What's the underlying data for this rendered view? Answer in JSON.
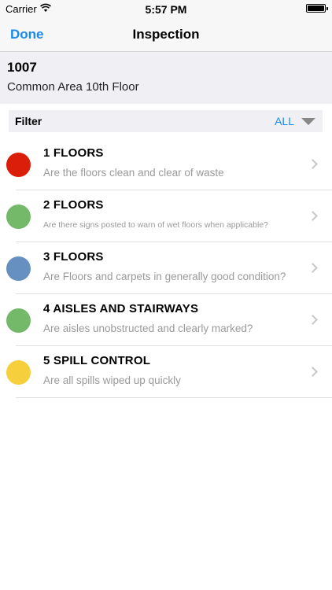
{
  "status_bar": {
    "carrier": "Carrier",
    "time": "5:57 PM"
  },
  "nav": {
    "done_label": "Done",
    "title": "Inspection"
  },
  "header": {
    "code": "1007",
    "location": "Common Area 10th Floor"
  },
  "filter": {
    "label": "Filter",
    "value": "ALL"
  },
  "items": [
    {
      "title": "1 FLOORS",
      "subtitle": "Are the floors clean and clear of waste",
      "status_color": "#db1e0a"
    },
    {
      "title": "2 FLOORS",
      "subtitle": "Are there signs posted to warn of wet floors when applicable?",
      "status_color": "#74b96a"
    },
    {
      "title": "3 FLOORS",
      "subtitle": "Are Floors and carpets in generally good condition?",
      "status_color": "#6690bf"
    },
    {
      "title": "4 AISLES AND STAIRWAYS",
      "subtitle": "Are aisles unobstructed and clearly marked?",
      "status_color": "#74b96a"
    },
    {
      "title": "5 SPILL CONTROL",
      "subtitle": "Are all spills wiped up quickly",
      "status_color": "#f6cf3c"
    }
  ],
  "colors": {
    "accent": "#1a8af0",
    "nav_background": "#f7f7f7",
    "header_background": "#efeff4"
  },
  "icons": {
    "wifi": "wifi-icon",
    "battery": "battery-icon",
    "dropdown": "triangle-down-icon",
    "chevron": "chevron-right-icon"
  }
}
